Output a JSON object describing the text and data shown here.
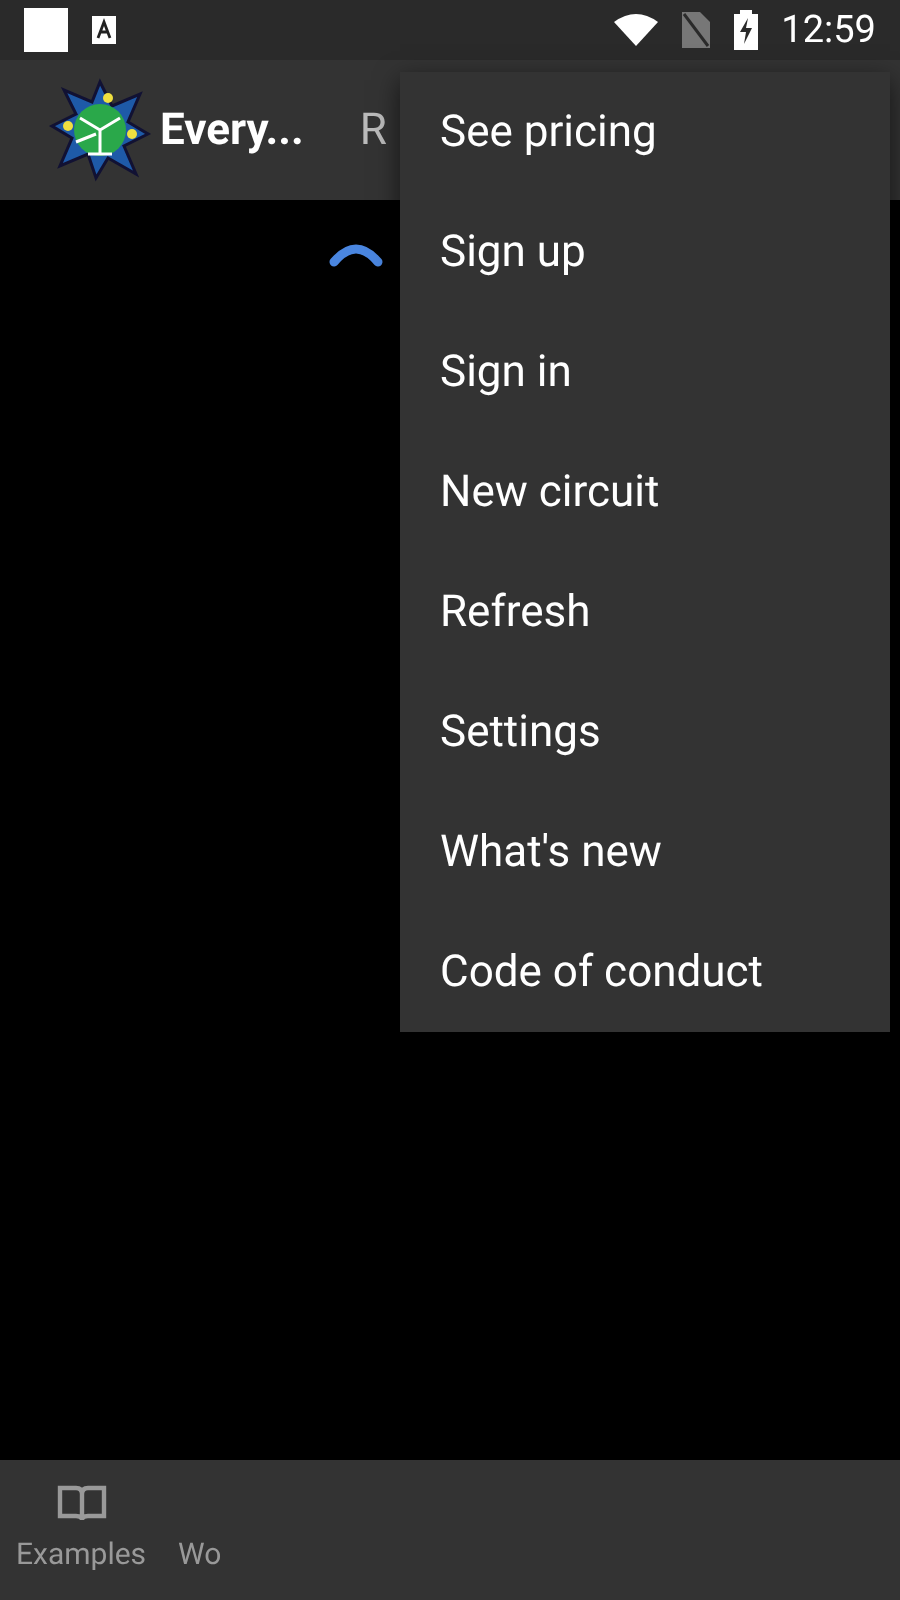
{
  "status_bar": {
    "time": "12:59"
  },
  "app_bar": {
    "title": "Every...",
    "tab_partial": "R"
  },
  "menu": {
    "items": [
      "See pricing",
      "Sign up",
      "Sign in",
      "New circuit",
      "Refresh",
      "Settings",
      "What's new",
      "Code of conduct"
    ]
  },
  "bottom_nav": {
    "items": [
      {
        "label": "Examples",
        "kind": "book"
      },
      {
        "label": "Wo",
        "kind": "none"
      }
    ]
  }
}
